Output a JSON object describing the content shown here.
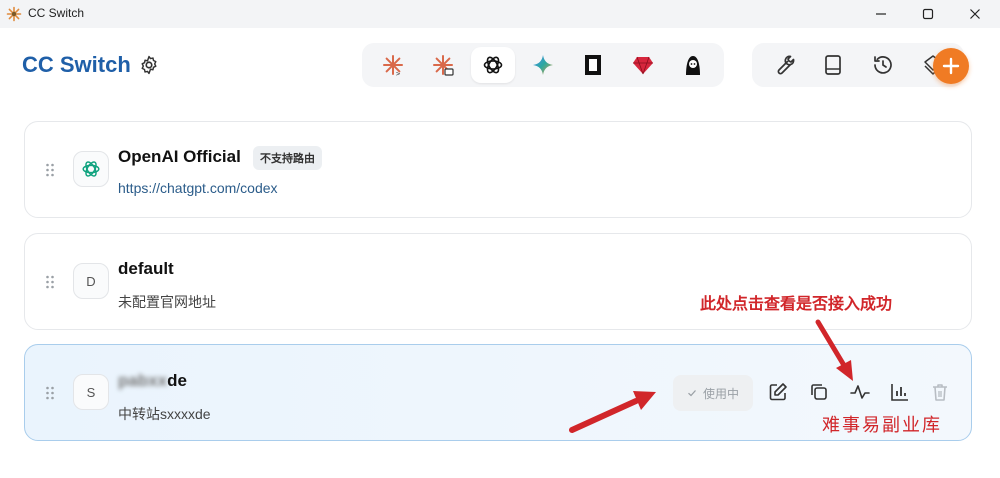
{
  "window": {
    "title": "CC Switch",
    "minimize_icon": "minimize-icon",
    "maximize_icon": "maximize-icon",
    "close_icon": "close-icon"
  },
  "header": {
    "brand": "CC Switch",
    "settings_icon": "gear-icon",
    "apps": [
      {
        "name": "claude-code",
        "icon": "claude-code-icon",
        "active": false
      },
      {
        "name": "claude-desktop",
        "icon": "claude-desktop-icon",
        "active": false
      },
      {
        "name": "openai-codex",
        "icon": "openai-icon",
        "active": true
      },
      {
        "name": "gemini",
        "icon": "gemini-icon",
        "active": false
      },
      {
        "name": "opencode",
        "icon": "opencode-icon",
        "active": false
      },
      {
        "name": "red-app",
        "icon": "ruby-icon",
        "active": false
      },
      {
        "name": "person-app",
        "icon": "person-icon",
        "active": false
      }
    ],
    "tools": [
      {
        "name": "wrench",
        "icon": "wrench-icon"
      },
      {
        "name": "book",
        "icon": "book-icon"
      },
      {
        "name": "history",
        "icon": "history-icon"
      },
      {
        "name": "prompts",
        "icon": "stack-icon"
      }
    ],
    "add_icon": "plus-icon",
    "accent_color": "#f07b24"
  },
  "providers": [
    {
      "avatar": "",
      "avatar_icon": "openai-icon",
      "name": "OpenAI Official",
      "badge": "不支持路由",
      "subtitle": "https://chatgpt.com/codex"
    },
    {
      "avatar": "D",
      "name": "default",
      "subtitle": "未配置官网地址"
    },
    {
      "avatar": "S",
      "name_blurred": "pabxx",
      "name_visible": "de",
      "subtitle": "中转站sxxxxde",
      "status": "使用中",
      "actions": [
        "edit-icon",
        "copy-icon",
        "pulse-icon",
        "bar-chart-icon",
        "trash-icon"
      ]
    }
  ],
  "annotations": {
    "top": "此处点击查看是否接入成功",
    "watermark": "难事易副业库",
    "color": "#d1262a"
  }
}
